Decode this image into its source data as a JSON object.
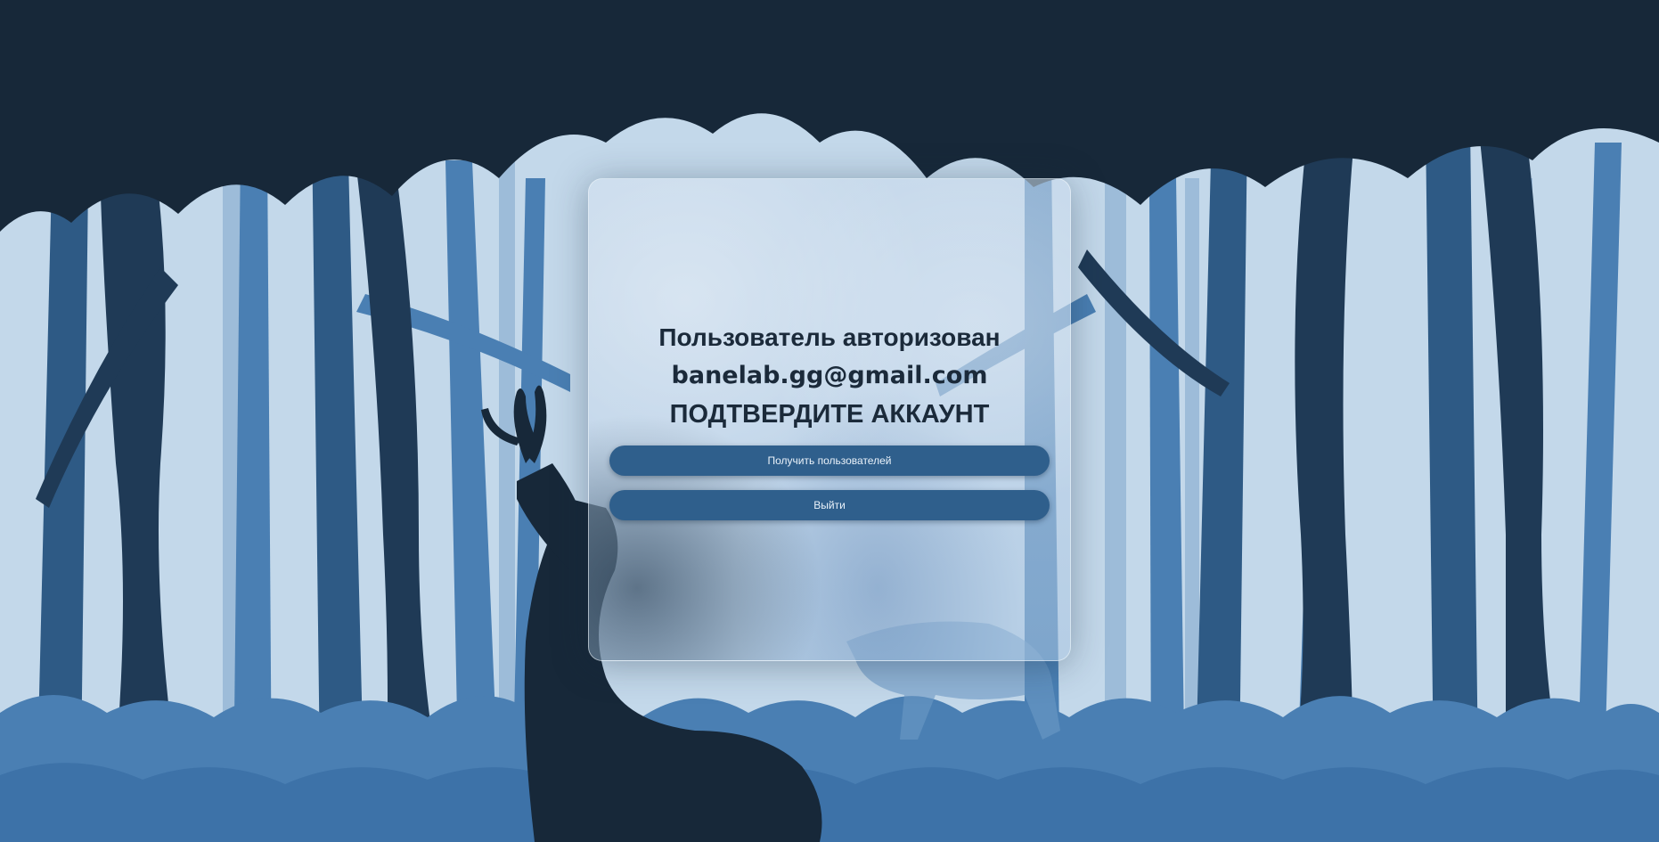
{
  "card": {
    "title": "Пользователь авторизован",
    "email": "banelab.gg@gmail.com",
    "status": "ПОДТВЕРДИТЕ АККАУНТ"
  },
  "buttons": {
    "get_users": "Получить пользователей",
    "logout": "Выйти"
  },
  "colors": {
    "sky": "#c3d8ea",
    "dark_tree": "#172839",
    "mid_tree": "#2e5a85",
    "light_tree": "#4a7fb3",
    "button": "#2f5f8c",
    "text": "#1b2a3a"
  }
}
